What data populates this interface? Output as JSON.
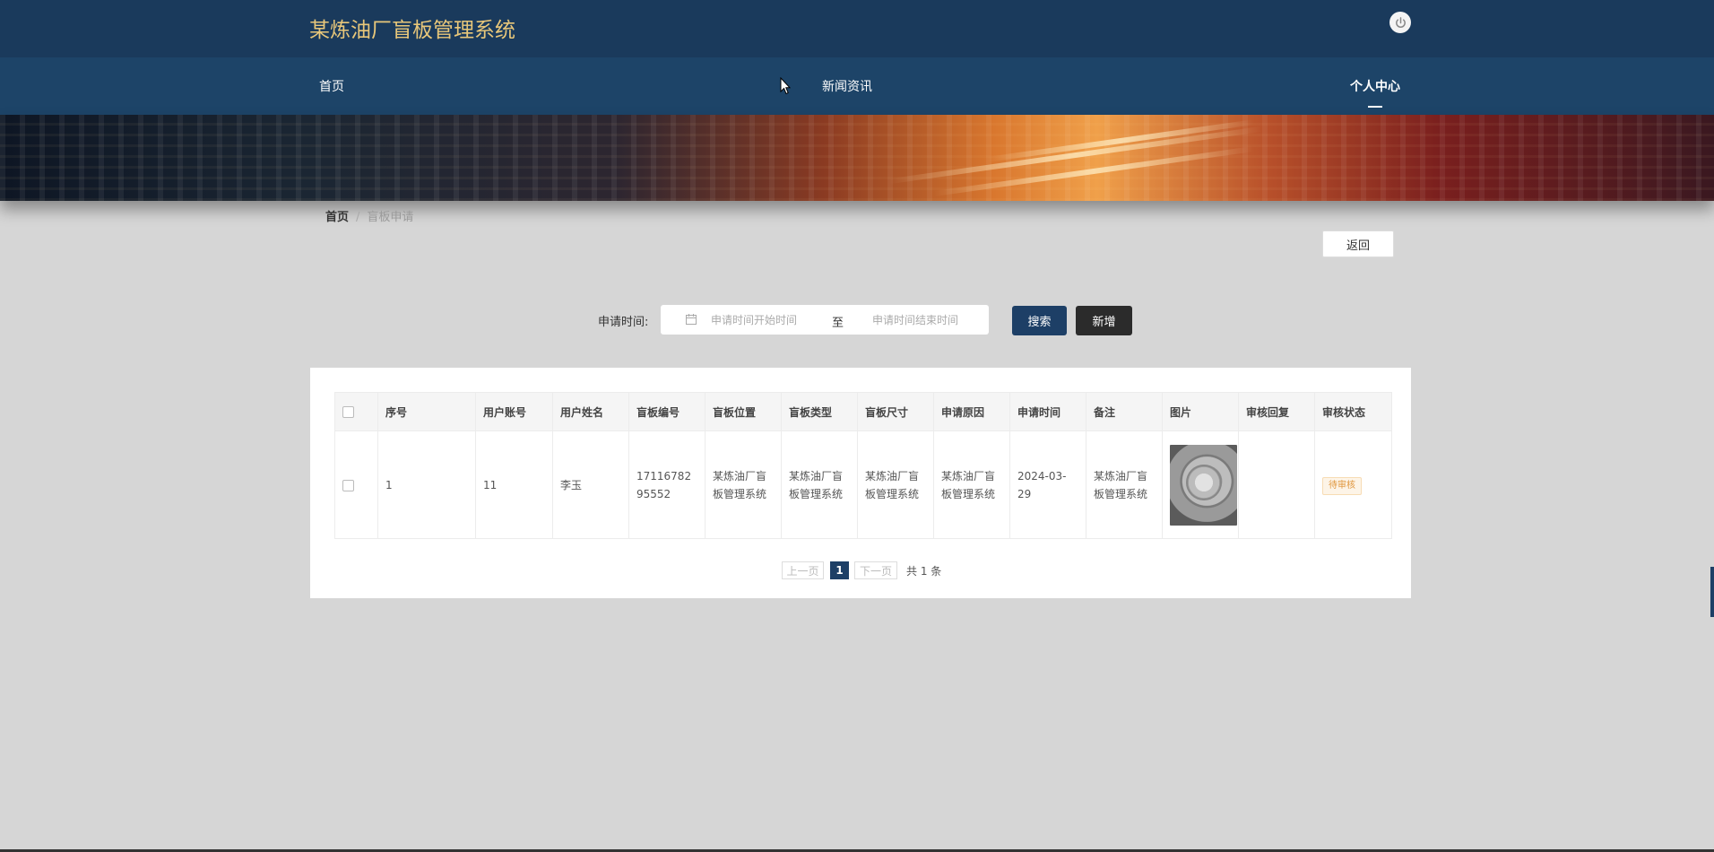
{
  "header": {
    "title": "某炼油厂盲板管理系统",
    "power_icon": "power-icon"
  },
  "nav": {
    "items": [
      {
        "label": "首页"
      },
      {
        "label": "新闻资讯"
      },
      {
        "label": "个人中心",
        "active": true
      }
    ]
  },
  "breadcrumb": {
    "home": "首页",
    "separator": "/",
    "current": "盲板申请"
  },
  "actions": {
    "back_label": "返回",
    "search_label": "搜索",
    "add_label": "新增"
  },
  "filter": {
    "label": "申请时间:",
    "start_placeholder": "申请时间开始时间",
    "separator": "至",
    "end_placeholder": "申请时间结束时间"
  },
  "table": {
    "columns": [
      "序号",
      "用户账号",
      "用户姓名",
      "盲板编号",
      "盲板位置",
      "盲板类型",
      "盲板尺寸",
      "申请原因",
      "申请时间",
      "备注",
      "图片",
      "审核回复",
      "审核状态"
    ],
    "rows": [
      {
        "index": "1",
        "account": "11",
        "name": "李玉",
        "code": "1711678295552",
        "location": "某炼油厂盲板管理系统",
        "type": "某炼油厂盲板管理系统",
        "size": "某炼油厂盲板管理系统",
        "reason": "某炼油厂盲板管理系统",
        "time": "2024-03-29",
        "remark": "某炼油厂盲板管理系统",
        "image": "blind-flange-photo",
        "reply": "",
        "status": "待审核"
      }
    ]
  },
  "pagination": {
    "prev_label": "上一页",
    "current_page": "1",
    "next_label": "下一页",
    "total_text": "共 1 条"
  },
  "colors": {
    "topbar": "#1a3a5c",
    "navbar": "#1d4468",
    "brand_text": "#e8c77a",
    "primary_button": "#1d3f66",
    "add_button": "#2b2b2b",
    "status_pending": "#e0963d"
  }
}
